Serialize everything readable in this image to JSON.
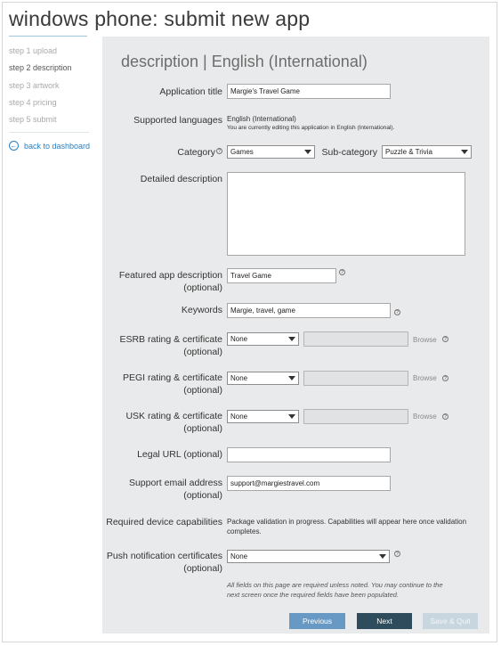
{
  "header": {
    "title": "windows phone: submit new app"
  },
  "sidebar": {
    "steps": [
      {
        "label": "step 1 upload"
      },
      {
        "label": "step 2 description"
      },
      {
        "label": "step 3 artwork"
      },
      {
        "label": "step 4 pricing"
      },
      {
        "label": "step 5 submit"
      }
    ],
    "active_step": 1,
    "back_label": "back to dashboard"
  },
  "form": {
    "section_title": "description | English (International)",
    "app_title": {
      "label": "Application title",
      "value": "Margie's Travel Game"
    },
    "languages": {
      "label": "Supported languages",
      "value": "English (International)",
      "note": "You are currently editing this application in English (International)."
    },
    "category": {
      "label": "Category",
      "value": "Games"
    },
    "subcategory": {
      "label": "Sub-category",
      "value": "Puzzle & Trivia"
    },
    "detailed_description": {
      "label": "Detailed description",
      "value": ""
    },
    "featured": {
      "label_line1": "Featured app description",
      "label_line2": "(optional)",
      "value": "Travel Game"
    },
    "keywords": {
      "label": "Keywords",
      "value": "Margie, travel, game"
    },
    "esrb": {
      "label_line1": "ESRB rating & certificate",
      "label_line2": "(optional)",
      "value": "None",
      "browse": "Browse"
    },
    "pegi": {
      "label_line1": "PEGI rating & certificate",
      "label_line2": "(optional)",
      "value": "None",
      "browse": "Browse"
    },
    "usk": {
      "label_line1": "USK rating & certificate",
      "label_line2": "(optional)",
      "value": "None",
      "browse": "Browse"
    },
    "legal_url": {
      "label": "Legal URL (optional)",
      "value": ""
    },
    "support_email": {
      "label_line1": "Support email address",
      "label_line2": "(optional)",
      "value": "support@margiestravel.com"
    },
    "capabilities": {
      "label": "Required device capabilities",
      "line1": "Package validation in progress. Capabilities will appear here once validation",
      "line2": "completes."
    },
    "push_cert": {
      "label_line1": "Push notification certificates",
      "label_line2": "(optional)",
      "value": "None"
    },
    "note_line1": "All fields on this page are required unless noted. You may continue to the",
    "note_line2": "next screen once the required fields have been populated."
  },
  "buttons": {
    "previous": "Previous",
    "next": "Next",
    "save_quit": "Save & Quit"
  },
  "colors": {
    "accent": "#2a7fc1",
    "panel": "#e8eaeb",
    "next_button": "#2e4c5c",
    "prev_button": "#6899c4"
  }
}
